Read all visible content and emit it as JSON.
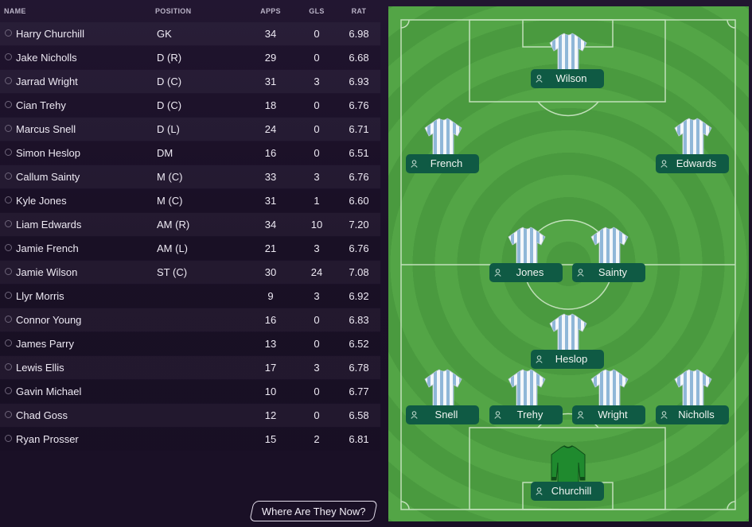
{
  "table": {
    "headers": {
      "name": "NAME",
      "position": "POSITION",
      "apps": "APPS",
      "gls": "GLS",
      "rat": "RAT"
    },
    "rows": [
      {
        "name": "Harry Churchill",
        "position": "GK",
        "apps": "34",
        "gls": "0",
        "rat": "6.98"
      },
      {
        "name": "Jake Nicholls",
        "position": "D (R)",
        "apps": "29",
        "gls": "0",
        "rat": "6.68"
      },
      {
        "name": "Jarrad Wright",
        "position": "D (C)",
        "apps": "31",
        "gls": "3",
        "rat": "6.93"
      },
      {
        "name": "Cian Trehy",
        "position": "D (C)",
        "apps": "18",
        "gls": "0",
        "rat": "6.76"
      },
      {
        "name": "Marcus Snell",
        "position": "D (L)",
        "apps": "24",
        "gls": "0",
        "rat": "6.71"
      },
      {
        "name": "Simon Heslop",
        "position": "DM",
        "apps": "16",
        "gls": "0",
        "rat": "6.51"
      },
      {
        "name": "Callum Sainty",
        "position": "M (C)",
        "apps": "33",
        "gls": "3",
        "rat": "6.76"
      },
      {
        "name": "Kyle Jones",
        "position": "M (C)",
        "apps": "31",
        "gls": "1",
        "rat": "6.60"
      },
      {
        "name": "Liam Edwards",
        "position": "AM (R)",
        "apps": "34",
        "gls": "10",
        "rat": "7.20"
      },
      {
        "name": "Jamie French",
        "position": "AM (L)",
        "apps": "21",
        "gls": "3",
        "rat": "6.76"
      },
      {
        "name": "Jamie Wilson",
        "position": "ST (C)",
        "apps": "30",
        "gls": "24",
        "rat": "7.08"
      },
      {
        "name": "Llyr Morris",
        "position": "",
        "apps": "9",
        "gls": "3",
        "rat": "6.92"
      },
      {
        "name": "Connor Young",
        "position": "",
        "apps": "16",
        "gls": "0",
        "rat": "6.83"
      },
      {
        "name": "James Parry",
        "position": "",
        "apps": "13",
        "gls": "0",
        "rat": "6.52"
      },
      {
        "name": "Lewis Ellis",
        "position": "",
        "apps": "17",
        "gls": "3",
        "rat": "6.78"
      },
      {
        "name": "Gavin Michael",
        "position": "",
        "apps": "10",
        "gls": "0",
        "rat": "6.77"
      },
      {
        "name": "Chad Goss",
        "position": "",
        "apps": "12",
        "gls": "0",
        "rat": "6.58"
      },
      {
        "name": "Ryan Prosser",
        "position": "",
        "apps": "15",
        "gls": "2",
        "rat": "6.81"
      }
    ]
  },
  "where_button": "Where Are They Now?",
  "pitch": {
    "players": [
      {
        "id": "wilson",
        "name": "Wilson",
        "kit": "outfield"
      },
      {
        "id": "french",
        "name": "French",
        "kit": "outfield"
      },
      {
        "id": "edwards",
        "name": "Edwards",
        "kit": "outfield"
      },
      {
        "id": "jones",
        "name": "Jones",
        "kit": "outfield"
      },
      {
        "id": "sainty",
        "name": "Sainty",
        "kit": "outfield"
      },
      {
        "id": "heslop",
        "name": "Heslop",
        "kit": "outfield"
      },
      {
        "id": "snell",
        "name": "Snell",
        "kit": "outfield"
      },
      {
        "id": "trehy",
        "name": "Trehy",
        "kit": "outfield"
      },
      {
        "id": "wright",
        "name": "Wright",
        "kit": "outfield"
      },
      {
        "id": "nicholls",
        "name": "Nicholls",
        "kit": "outfield"
      },
      {
        "id": "churchill",
        "name": "Churchill",
        "kit": "goalkeeper"
      }
    ]
  },
  "colors": {
    "background": "#1b1128",
    "pitch_light": "#53a546",
    "pitch_dark": "#4a9a3f",
    "label_bg": "#0f5a44",
    "shirt_stripe": "#8fb7d8",
    "gk_shirt": "#1f8a2e"
  }
}
